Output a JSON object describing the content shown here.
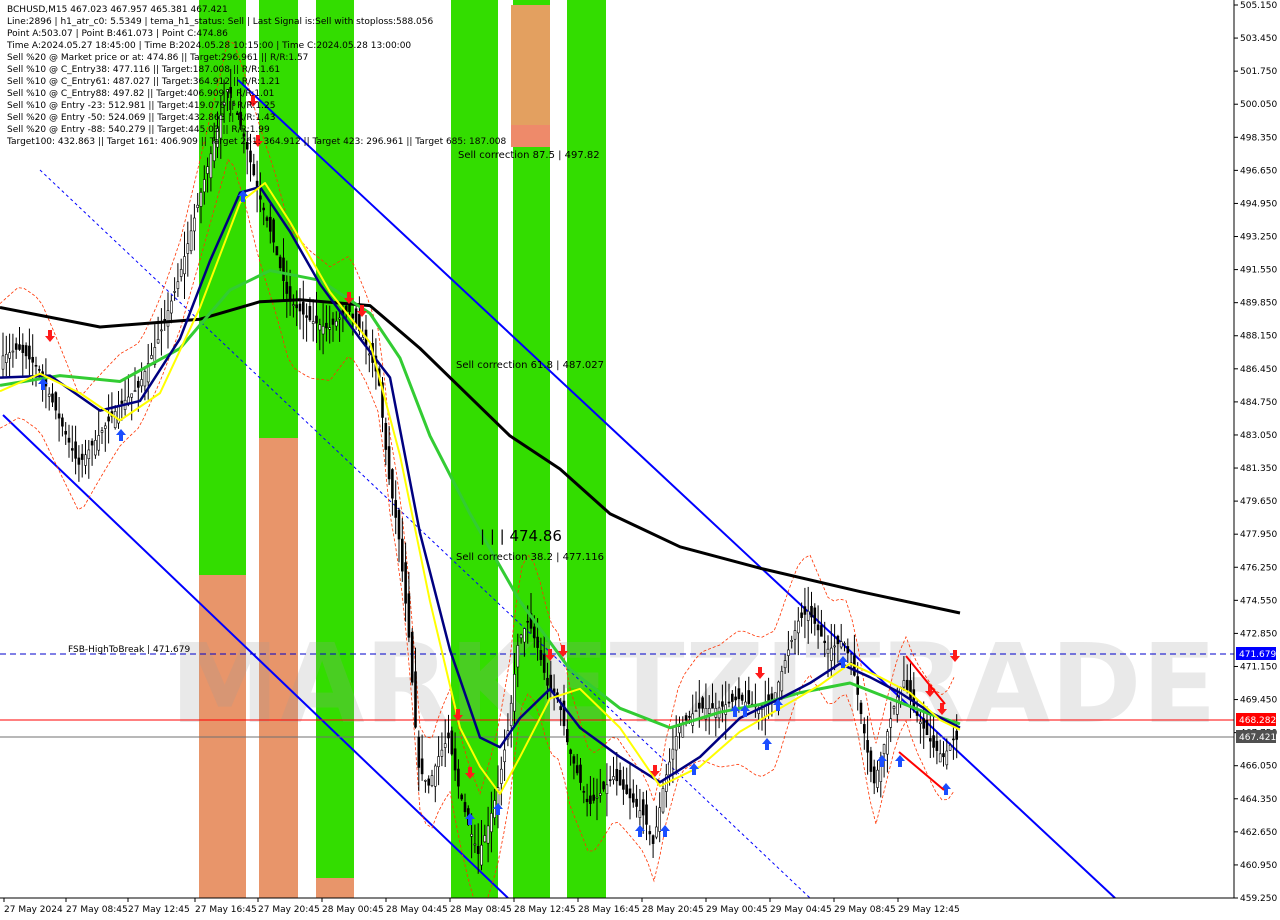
{
  "info": {
    "lines": [
      "BCHUSD,M15  467.023 467.957 465.381 467.421",
      "Line:2896  |  h1_atr_c0: 5.5349  |  tema_h1_status: Sell  |  Last Signal is:Sell with stoploss:588.056",
      "Point A:503.07  |  Point B:461.073  |  Point C:474.86",
      "Time A:2024.05.27 18:45:00  |  Time B:2024.05.28 10:15:00  |  Time C:2024.05.28 13:00:00",
      "Sell %20 @ Market price or at: 474.86  ||  Target:296.961  ||  R/R:1.57",
      "Sell %10 @ C_Entry38: 477.116  ||  Target:187.008  ||  R/R:1.61",
      "Sell %10 @ C_Entry61: 487.027  ||  Target:364.912  ||  R/R:1.21",
      "Sell %10 @ C_Entry88: 497.82  ||  Target:406.909  ||  R/R:1.01",
      "Sell %10 @ Entry -23: 512.981  ||  Target:419.076  ||  R/R:1.25",
      "Sell %20 @ Entry -50: 524.069  ||  Target:432.863  ||  R/R:1.43",
      "Sell %20 @ Entry -88: 540.279  ||  Target:445.03  ||  R/R:1.99",
      "Target100: 432.863  ||  Target 161: 406.909  ||  Target 261: 364.912  ||  Target 423: 296.961  ||  Target 685: 187.008"
    ]
  },
  "watermark": "MARKETZITRADE",
  "labels": {
    "sell_corr_875": "Sell correction 87.5 | 497.82",
    "sell_corr_618": "Sell correction 61.8 | 487.027",
    "sell_corr_382": "Sell correction 38.2 | 477.116",
    "point_c": "| | |  474.86",
    "fsb": "FSB-HighToBreak  |  471.679"
  },
  "price_tags": {
    "fsb": "471.679",
    "red_line": "468.282",
    "current": "467.421"
  },
  "colors": {
    "bull_zone": "#33dd00",
    "bear_zone": "#e8956a",
    "bear_zone_light": "#e9a06e",
    "ma_black": "#000000",
    "ma_green": "#33cc33",
    "ma_navy": "#000080",
    "ma_yellow": "#ffff00",
    "channel_blue": "#0000ff",
    "red_line": "#ff0000",
    "fsb_line": "#0000cc",
    "tag_blue": "#0000ff",
    "tag_red": "#ff0000",
    "tag_gray": "#505050"
  },
  "chart_data": {
    "type": "candlestick",
    "symbol": "BCHUSD",
    "timeframe": "M15",
    "ylim": [
      459.25,
      505.15
    ],
    "y_ticks": [
      "505.150",
      "503.450",
      "501.750",
      "500.050",
      "498.350",
      "496.650",
      "494.950",
      "493.250",
      "491.550",
      "489.850",
      "488.150",
      "486.450",
      "484.750",
      "483.050",
      "481.350",
      "479.650",
      "477.950",
      "476.250",
      "474.550",
      "472.850",
      "471.150",
      "469.450",
      "467.750",
      "466.050",
      "464.350",
      "462.650",
      "460.950",
      "459.250"
    ],
    "x_ticks": [
      "27 May 2024",
      "27 May 08:45",
      "27 May 12:45",
      "27 May 16:45",
      "27 May 20:45",
      "28 May 00:45",
      "28 May 04:45",
      "28 May 08:45",
      "28 May 12:45",
      "28 May 16:45",
      "28 May 20:45",
      "29 May 00:45",
      "29 May 04:45",
      "29 May 08:45",
      "29 May 12:45"
    ],
    "ohlc_last": {
      "open": 467.023,
      "high": 467.957,
      "low": 465.381,
      "close": 467.421
    },
    "horizontal_levels": [
      {
        "name": "FSB-HighToBreak",
        "value": 471.679
      },
      {
        "name": "red line",
        "value": 468.282
      },
      {
        "name": "current",
        "value": 467.421
      }
    ],
    "price_path": [
      [
        0,
        487.0
      ],
      [
        20,
        487.5
      ],
      [
        40,
        486.5
      ],
      [
        60,
        484.0
      ],
      [
        80,
        481.5
      ],
      [
        100,
        483.0
      ],
      [
        120,
        484.5
      ],
      [
        140,
        485.5
      ],
      [
        160,
        488.0
      ],
      [
        180,
        491.0
      ],
      [
        200,
        495.0
      ],
      [
        215,
        498.0
      ],
      [
        230,
        501.0
      ],
      [
        245,
        498.5
      ],
      [
        260,
        495.5
      ],
      [
        275,
        493.0
      ],
      [
        290,
        490.0
      ],
      [
        310,
        489.0
      ],
      [
        330,
        488.5
      ],
      [
        350,
        489.5
      ],
      [
        365,
        488.0
      ],
      [
        380,
        486.0
      ],
      [
        390,
        481.0
      ],
      [
        400,
        478.0
      ],
      [
        410,
        473.0
      ],
      [
        420,
        466.0
      ],
      [
        430,
        465.0
      ],
      [
        440,
        466.5
      ],
      [
        450,
        467.5
      ],
      [
        460,
        465.0
      ],
      [
        470,
        463.0
      ],
      [
        480,
        461.5
      ],
      [
        490,
        463.0
      ],
      [
        500,
        465.0
      ],
      [
        510,
        468.0
      ],
      [
        520,
        472.5
      ],
      [
        530,
        473.5
      ],
      [
        540,
        472.0
      ],
      [
        550,
        470.0
      ],
      [
        560,
        469.5
      ],
      [
        570,
        467.0
      ],
      [
        580,
        465.5
      ],
      [
        590,
        464.0
      ],
      [
        600,
        464.5
      ],
      [
        615,
        465.5
      ],
      [
        630,
        464.5
      ],
      [
        645,
        463.5
      ],
      [
        655,
        462.0
      ],
      [
        665,
        465.0
      ],
      [
        680,
        468.0
      ],
      [
        700,
        469.0
      ],
      [
        720,
        469.0
      ],
      [
        740,
        469.5
      ],
      [
        760,
        469.0
      ],
      [
        775,
        469.5
      ],
      [
        790,
        472.0
      ],
      [
        800,
        473.5
      ],
      [
        810,
        474.0
      ],
      [
        820,
        473.0
      ],
      [
        830,
        472.0
      ],
      [
        845,
        472.5
      ],
      [
        855,
        471.0
      ],
      [
        865,
        468.0
      ],
      [
        875,
        465.0
      ],
      [
        885,
        467.0
      ],
      [
        895,
        469.0
      ],
      [
        905,
        470.5
      ],
      [
        915,
        469.0
      ],
      [
        925,
        468.0
      ],
      [
        935,
        467.0
      ],
      [
        945,
        466.5
      ],
      [
        955,
        467.4
      ]
    ],
    "series": [
      {
        "name": "MA black",
        "points": [
          [
            0,
            489.6
          ],
          [
            100,
            488.6
          ],
          [
            200,
            489.0
          ],
          [
            260,
            489.9
          ],
          [
            300,
            490.0
          ],
          [
            370,
            489.7
          ],
          [
            420,
            487.5
          ],
          [
            510,
            483.0
          ],
          [
            560,
            481.3
          ],
          [
            610,
            479.0
          ],
          [
            680,
            477.3
          ],
          [
            760,
            476.2
          ],
          [
            860,
            475.0
          ],
          [
            960,
            473.9
          ]
        ]
      },
      {
        "name": "MA green",
        "points": [
          [
            0,
            485.6
          ],
          [
            60,
            486.1
          ],
          [
            120,
            485.8
          ],
          [
            180,
            487.5
          ],
          [
            230,
            490.5
          ],
          [
            270,
            491.5
          ],
          [
            320,
            491.0
          ],
          [
            370,
            489.3
          ],
          [
            400,
            487.0
          ],
          [
            430,
            483.0
          ],
          [
            470,
            479.0
          ],
          [
            520,
            474.5
          ],
          [
            570,
            471.0
          ],
          [
            620,
            469.0
          ],
          [
            670,
            468.0
          ],
          [
            720,
            468.8
          ],
          [
            760,
            469.2
          ],
          [
            800,
            469.8
          ],
          [
            850,
            470.3
          ],
          [
            890,
            469.5
          ],
          [
            930,
            468.7
          ],
          [
            960,
            468.2
          ]
        ]
      },
      {
        "name": "MA navy",
        "points": [
          [
            0,
            486.0
          ],
          [
            50,
            486.1
          ],
          [
            100,
            484.3
          ],
          [
            140,
            484.8
          ],
          [
            180,
            488.0
          ],
          [
            210,
            492.0
          ],
          [
            240,
            495.5
          ],
          [
            260,
            495.8
          ],
          [
            290,
            493.5
          ],
          [
            320,
            490.8
          ],
          [
            360,
            488.0
          ],
          [
            390,
            486.0
          ],
          [
            420,
            478.0
          ],
          [
            450,
            472.0
          ],
          [
            480,
            467.5
          ],
          [
            500,
            467.0
          ],
          [
            520,
            468.5
          ],
          [
            550,
            470.0
          ],
          [
            580,
            468.0
          ],
          [
            620,
            466.5
          ],
          [
            660,
            465.2
          ],
          [
            700,
            466.5
          ],
          [
            740,
            468.5
          ],
          [
            780,
            469.5
          ],
          [
            810,
            470.3
          ],
          [
            840,
            471.3
          ],
          [
            870,
            470.6
          ],
          [
            900,
            469.8
          ],
          [
            930,
            468.8
          ],
          [
            960,
            468.0
          ]
        ]
      },
      {
        "name": "MA yellow",
        "points": [
          [
            0,
            485.3
          ],
          [
            40,
            486.2
          ],
          [
            80,
            485.2
          ],
          [
            120,
            483.8
          ],
          [
            160,
            485.2
          ],
          [
            200,
            489.6
          ],
          [
            240,
            495.0
          ],
          [
            265,
            496.0
          ],
          [
            290,
            494.0
          ],
          [
            330,
            490.4
          ],
          [
            370,
            487.8
          ],
          [
            400,
            482.0
          ],
          [
            430,
            474.5
          ],
          [
            460,
            468.0
          ],
          [
            480,
            466.0
          ],
          [
            500,
            464.6
          ],
          [
            520,
            466.5
          ],
          [
            550,
            469.5
          ],
          [
            580,
            470.0
          ],
          [
            620,
            468.0
          ],
          [
            660,
            465.0
          ],
          [
            700,
            466.0
          ],
          [
            740,
            467.8
          ],
          [
            780,
            469.0
          ],
          [
            820,
            470.2
          ],
          [
            850,
            471.3
          ],
          [
            880,
            470.6
          ],
          [
            910,
            469.8
          ],
          [
            940,
            468.4
          ],
          [
            960,
            467.9
          ]
        ]
      }
    ]
  }
}
